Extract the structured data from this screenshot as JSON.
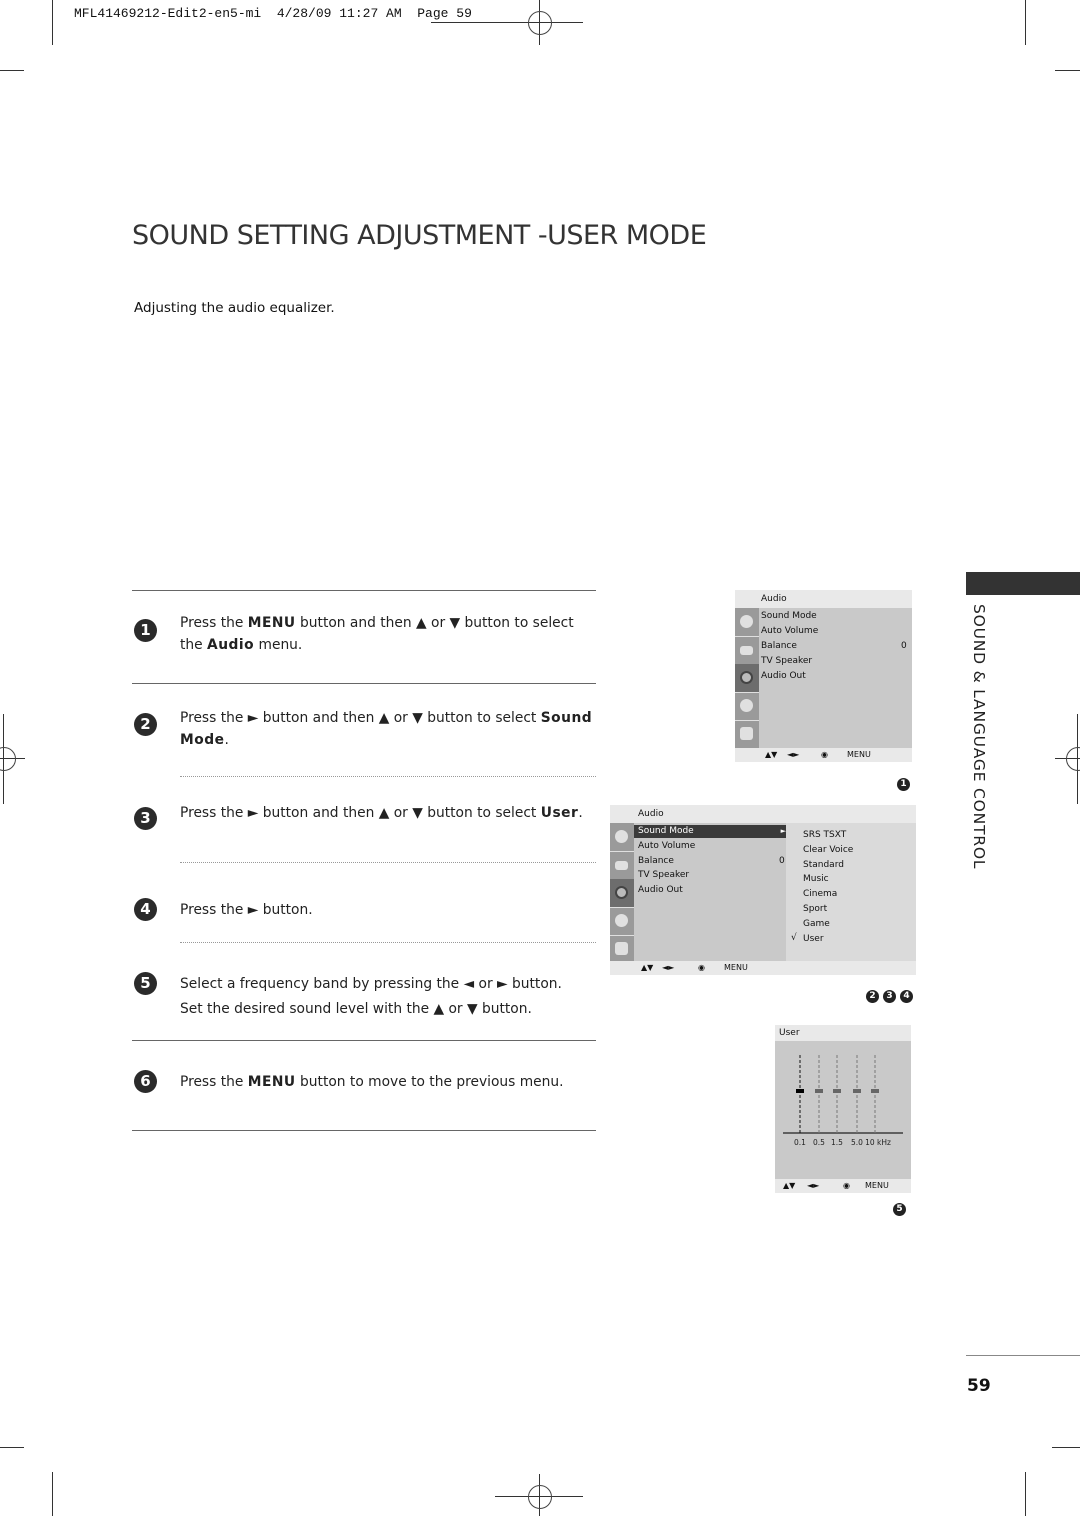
{
  "print_slug": "MFL41469212-Edit2-en5-mi  4/28/09 11:27 AM  Page 59",
  "title": "SOUND SETTING ADJUSTMENT -USER MODE",
  "subtitle": "Adjusting the audio equalizer.",
  "side_label": "SOUND & LANGUAGE CONTROL",
  "page_number": "59",
  "steps": [
    {
      "num": "1",
      "parts": [
        "Press the ",
        "MENU",
        " button and then ▲ or ▼ button to select the ",
        "Audio",
        " menu."
      ]
    },
    {
      "num": "2",
      "parts": [
        "Press the ► button and then ▲ or ▼ button to select ",
        "Sound Mode",
        "."
      ]
    },
    {
      "num": "3",
      "parts": [
        "Press the ► button and then ▲ or ▼ button to select ",
        "User",
        "."
      ]
    },
    {
      "num": "4",
      "parts": [
        "Press the ► button."
      ]
    },
    {
      "num": "5",
      "parts": [
        "Select a frequency band by pressing the ◄ or ► button.",
        "Set the desired sound level with the ▲ or ▼ button."
      ]
    },
    {
      "num": "6",
      "parts": [
        "Press the ",
        "MENU",
        " button to move to the previous menu."
      ]
    }
  ],
  "osd1": {
    "header": "Audio",
    "items": [
      "Sound Mode",
      "Auto Volume",
      "Balance",
      "TV Speaker",
      "Audio Out"
    ],
    "balance_value": "0",
    "footer": {
      "nav": "▲▼",
      "lr": "◄►",
      "ok": "◉",
      "menu": "MENU"
    },
    "ref": "1"
  },
  "osd2": {
    "header": "Audio",
    "items": [
      "Sound Mode",
      "Auto Volume",
      "Balance",
      "TV Speaker",
      "Audio Out"
    ],
    "selected": "Sound Mode",
    "arrow": "►",
    "balance_value": "0",
    "submenu": [
      "SRS TSXT",
      "Clear Voice",
      "Standard",
      "Music",
      "Cinema",
      "Sport",
      "Game",
      "User"
    ],
    "checked": "User",
    "check_mark": "√",
    "footer": {
      "nav": "▲▼",
      "lr": "◄►",
      "ok": "◉",
      "menu": "MENU"
    },
    "refs": [
      "2",
      "3",
      "4"
    ]
  },
  "osd3": {
    "header": "User",
    "bands": [
      "0.1",
      "0.5",
      "1.5",
      "5.0",
      "10 kHz"
    ],
    "selected_band": "0.1",
    "levels": [
      0,
      0,
      0,
      0,
      0
    ],
    "footer": {
      "nav": "▲▼",
      "lr": "◄►",
      "ok": "◉",
      "menu": "MENU"
    },
    "ref": "5"
  }
}
